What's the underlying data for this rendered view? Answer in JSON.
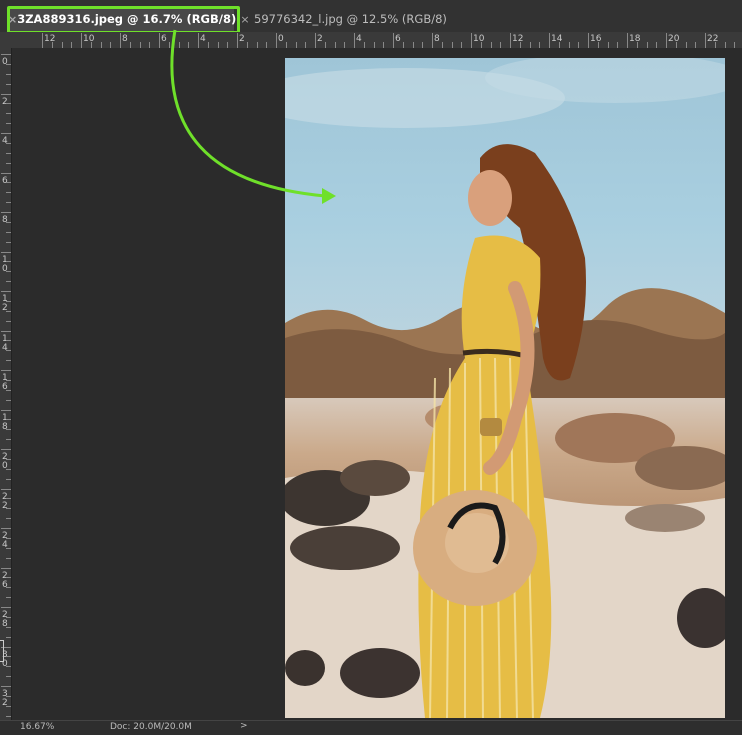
{
  "tabs": [
    {
      "label": "3ZA889316.jpeg @ 16.7% (RGB/8)",
      "close": "×",
      "active": true
    },
    {
      "label": "59776342_l.jpg @ 12.5% (RGB/8)",
      "close": "×",
      "active": false
    }
  ],
  "ruler_top": [
    "12",
    "10",
    "8",
    "6",
    "4",
    "2",
    "0",
    "2",
    "4",
    "6",
    "8",
    "10",
    "12",
    "14",
    "16",
    "18",
    "20",
    "22"
  ],
  "ruler_left": [
    "0",
    "2",
    "4",
    "6",
    "8",
    "1\n0",
    "1\n2",
    "1\n4",
    "1\n6",
    "1\n8",
    "2\n0",
    "2\n2",
    "2\n4",
    "2\n6",
    "2\n8",
    "3\n0",
    "3\n2"
  ],
  "status": {
    "zoom": "16.67%",
    "doc": "Doc: 20.0M/20.0M",
    "caret": ">"
  },
  "colors": {
    "highlight": "#6fe02a",
    "arrow": "#6fe02a"
  },
  "icons": {
    "tab_close": "close-icon",
    "status_caret": "chevron-right-icon"
  }
}
